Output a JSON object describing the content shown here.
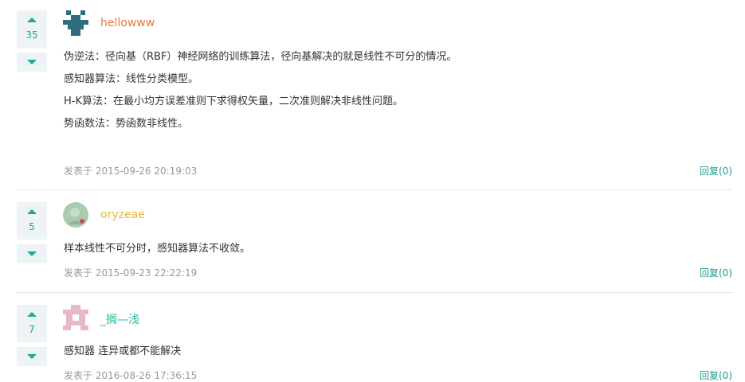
{
  "comments": [
    {
      "votes": "35",
      "username": "hellowww",
      "username_color": "#e8763a",
      "avatar_icon": "identicon-teal",
      "lines": [
        "伪逆法：径向基（RBF）神经网络的训练算法，径向基解决的就是线性不可分的情况。",
        "感知器算法：线性分类模型。",
        "H-K算法：在最小均方误差准则下求得权矢量，二次准则解决非线性问题。",
        "势函数法：势函数非线性。"
      ],
      "posted": "发表于 2015-09-26 20:19:03",
      "reply": "回复(0)"
    },
    {
      "votes": "5",
      "username": "oryzeae",
      "username_color": "#e8b93a",
      "avatar_icon": "photo-avatar",
      "lines": [
        "样本线性不可分时，感知器算法不收敛。"
      ],
      "posted": "发表于 2015-09-23 22:22:19",
      "reply": "回复(0)"
    },
    {
      "votes": "7",
      "username": "_搁—浅",
      "username_color": "#2bb5a5",
      "avatar_icon": "identicon-pink",
      "lines": [
        "感知器 连异或都不能解决"
      ],
      "posted": "发表于 2016-08-26 17:36:15",
      "reply": "回复(0)"
    }
  ]
}
